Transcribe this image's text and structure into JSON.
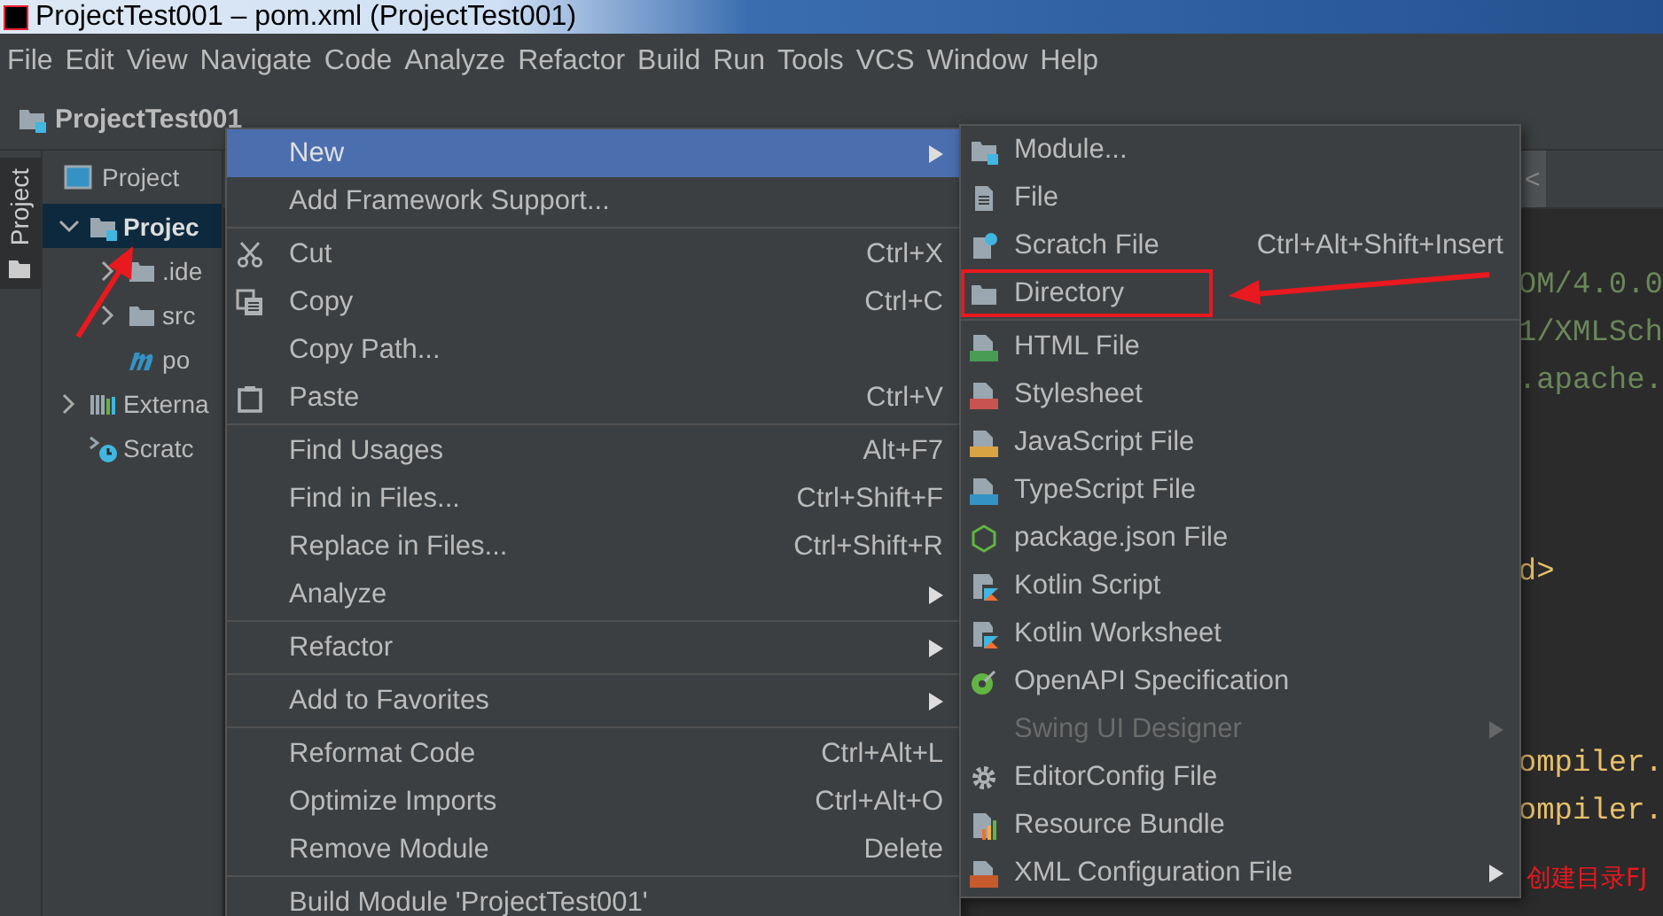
{
  "window": {
    "title": "ProjectTest001 – pom.xml (ProjectTest001)"
  },
  "menu_bar": [
    "File",
    "Edit",
    "View",
    "Navigate",
    "Code",
    "Analyze",
    "Refactor",
    "Build",
    "Run",
    "Tools",
    "VCS",
    "Window",
    "Help"
  ],
  "nav_bar": {
    "project": "ProjectTest001"
  },
  "tool_stripe": {
    "tab": "Project"
  },
  "project_panel": {
    "view": "Project",
    "tree": [
      {
        "label": "Projec",
        "kind": "module",
        "expanded": true,
        "selected": true,
        "children": [
          {
            "label": ".ide",
            "kind": "folder",
            "expanded": false,
            "selected": false
          },
          {
            "label": "src",
            "kind": "folder",
            "expanded": false,
            "selected": false
          },
          {
            "label": "po",
            "kind": "maven",
            "selected": false
          }
        ]
      },
      {
        "label": "Externa",
        "kind": "libraries",
        "expanded": false,
        "selected": false
      },
      {
        "label": "Scratc",
        "kind": "scratch",
        "selected": false
      }
    ]
  },
  "editor": {
    "tab_arrow": "<",
    "code_blocks": [
      [
        {
          "text": "OM/4.0.0",
          "kind": "string"
        },
        {
          "text": "1/XMLSch",
          "kind": "string"
        },
        {
          "text": ".apache.",
          "kind": "string"
        }
      ],
      [
        {
          "text": "d>",
          "kind": "tag"
        }
      ],
      [
        {
          "text": "ompiler.",
          "kind": "tag"
        },
        {
          "text": "ompiler.",
          "kind": "tag"
        }
      ]
    ]
  },
  "context_menu": {
    "items": [
      {
        "kind": "plain",
        "label": "New",
        "selected": true,
        "submenu": true
      },
      {
        "kind": "plain",
        "label": "Add Framework Support...",
        "selected": false,
        "submenu": false
      },
      {
        "kind": "separator"
      },
      {
        "kind": "cut",
        "label": "Cut",
        "shortcut": "Ctrl+X",
        "selected": false,
        "submenu": false
      },
      {
        "kind": "copy",
        "label": "Copy",
        "shortcut": "Ctrl+C",
        "selected": false,
        "submenu": false
      },
      {
        "kind": "plain",
        "label": "Copy Path...",
        "selected": false,
        "submenu": false
      },
      {
        "kind": "paste",
        "label": "Paste",
        "shortcut": "Ctrl+V",
        "selected": false,
        "submenu": false
      },
      {
        "kind": "separator"
      },
      {
        "kind": "plain",
        "label": "Find Usages",
        "shortcut": "Alt+F7",
        "selected": false,
        "submenu": false
      },
      {
        "kind": "plain",
        "label": "Find in Files...",
        "shortcut": "Ctrl+Shift+F",
        "selected": false,
        "submenu": false
      },
      {
        "kind": "plain",
        "label": "Replace in Files...",
        "shortcut": "Ctrl+Shift+R",
        "selected": false,
        "submenu": false
      },
      {
        "kind": "plain",
        "label": "Analyze",
        "selected": false,
        "submenu": true
      },
      {
        "kind": "separator"
      },
      {
        "kind": "plain",
        "label": "Refactor",
        "selected": false,
        "submenu": true
      },
      {
        "kind": "separator"
      },
      {
        "kind": "plain",
        "label": "Add to Favorites",
        "selected": false,
        "submenu": true
      },
      {
        "kind": "separator"
      },
      {
        "kind": "plain",
        "label": "Reformat Code",
        "shortcut": "Ctrl+Alt+L",
        "selected": false,
        "submenu": false
      },
      {
        "kind": "plain",
        "label": "Optimize Imports",
        "shortcut": "Ctrl+Alt+O",
        "selected": false,
        "submenu": false
      },
      {
        "kind": "plain",
        "label": "Remove Module",
        "shortcut": "Delete",
        "selected": false,
        "submenu": false
      },
      {
        "kind": "separator"
      },
      {
        "kind": "plain",
        "label": "Build Module 'ProjectTest001'",
        "selected": false,
        "submenu": false
      }
    ]
  },
  "new_submenu": {
    "items": [
      {
        "kind": "module",
        "label": "Module...",
        "disabled": false,
        "highlighted": false,
        "submenu": false
      },
      {
        "kind": "file",
        "label": "File",
        "disabled": false,
        "highlighted": false,
        "submenu": false
      },
      {
        "kind": "scratch",
        "label": "Scratch File",
        "shortcut": "Ctrl+Alt+Shift+Insert",
        "disabled": false,
        "highlighted": false,
        "submenu": false
      },
      {
        "kind": "folder",
        "label": "Directory",
        "disabled": false,
        "highlighted": true,
        "submenu": false
      },
      {
        "kind": "separator"
      },
      {
        "kind": "html",
        "label": "HTML File",
        "disabled": false,
        "highlighted": false,
        "submenu": false
      },
      {
        "kind": "css",
        "label": "Stylesheet",
        "disabled": false,
        "highlighted": false,
        "submenu": false
      },
      {
        "kind": "js",
        "label": "JavaScript File",
        "disabled": false,
        "highlighted": false,
        "submenu": false
      },
      {
        "kind": "ts",
        "label": "TypeScript File",
        "disabled": false,
        "highlighted": false,
        "submenu": false
      },
      {
        "kind": "npm",
        "label": "package.json File",
        "disabled": false,
        "highlighted": false,
        "submenu": false
      },
      {
        "kind": "kotlin",
        "label": "Kotlin Script",
        "disabled": false,
        "highlighted": false,
        "submenu": false
      },
      {
        "kind": "kotlin",
        "label": "Kotlin Worksheet",
        "disabled": false,
        "highlighted": false,
        "submenu": false
      },
      {
        "kind": "openapi",
        "label": "OpenAPI Specification",
        "disabled": false,
        "highlighted": false,
        "submenu": false
      },
      {
        "kind": "plain",
        "label": "Swing UI Designer",
        "disabled": true,
        "highlighted": false,
        "submenu": true
      },
      {
        "kind": "gear",
        "label": "EditorConfig File",
        "disabled": false,
        "highlighted": false,
        "submenu": false
      },
      {
        "kind": "bundle",
        "label": "Resource Bundle",
        "disabled": false,
        "highlighted": false,
        "submenu": false
      },
      {
        "kind": "xml",
        "label": "XML Configuration File",
        "disabled": false,
        "highlighted": false,
        "submenu": true
      }
    ]
  },
  "annotation_text": "创建目录FJ"
}
